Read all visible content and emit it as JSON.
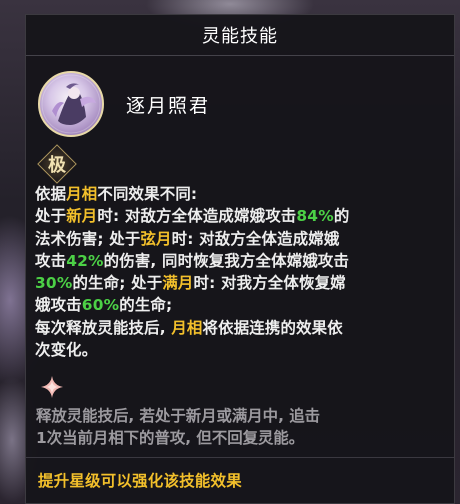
{
  "panel": {
    "title": "灵能技能"
  },
  "skill": {
    "name": "逐月照君",
    "rank_badge": "极",
    "icon": "moon-goddess-portrait-icon"
  },
  "description": {
    "line1": {
      "a": "依据",
      "b": "月相",
      "c": "不同效果不同:"
    },
    "line2": {
      "a": "处于",
      "b": "新月",
      "c": "时: 对敌方全体造成嫦娥攻击",
      "d": "84%",
      "e": "的"
    },
    "line3": {
      "a": "法术伤害; 处于",
      "b": "弦月",
      "c": "时: 对敌方全体造成嫦娥"
    },
    "line4": {
      "a": "攻击",
      "b": "42%",
      "c": "的伤害, 同时恢复我方全体嫦娥攻击"
    },
    "line5": {
      "a": "30%",
      "b": "的生命; 处于",
      "c": "满月",
      "d": "时: 对我方全体恢复嫦"
    },
    "line6": {
      "a": "娥攻击",
      "b": "60%",
      "c": "的生命;"
    },
    "line7": {
      "a": "每次释放灵能技后, ",
      "b": "月相",
      "c": "将依据连携的效果依"
    },
    "line8": "次变化。"
  },
  "extra_effect": {
    "icon": "four-point-star-icon",
    "line1": "释放灵能技后, 若处于新月或满月中, 追击",
    "line2": "1次当前月相下的普攻, 但不回复灵能。"
  },
  "footer": {
    "text": "提升星级可以强化该技能效果"
  },
  "colors": {
    "highlight_yellow": "#f3c02b",
    "highlight_green": "#4cd046",
    "panel_bg": "#16151a"
  }
}
